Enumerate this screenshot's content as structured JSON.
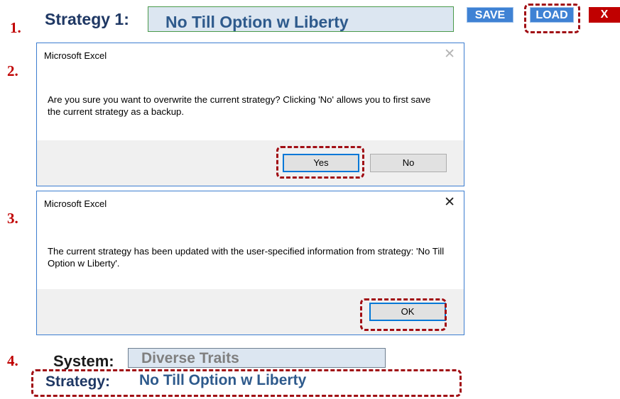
{
  "steps": [
    "1.",
    "2.",
    "3.",
    "4."
  ],
  "strategy_bar": {
    "label": "Strategy 1:",
    "value": "No Till Option w Liberty",
    "save_label": "SAVE",
    "load_label": "LOAD",
    "close_label": "X"
  },
  "dialog_confirm": {
    "title": "Microsoft Excel",
    "close_glyph": "✕",
    "message": "Are you sure you want to overwrite the current strategy? Clicking 'No' allows you to first save the current strategy as a backup.",
    "yes_label": "Yes",
    "no_label": "No"
  },
  "dialog_done": {
    "title": "Microsoft Excel",
    "close_glyph": "✕",
    "message": "The current strategy has been updated with the user-specified information from strategy: 'No Till Option w Liberty'.",
    "ok_label": "OK"
  },
  "result": {
    "system_label": "System:",
    "system_value": "Diverse Traits",
    "strategy_label": "Strategy:",
    "strategy_value": "No Till Option w Liberty"
  },
  "colors": {
    "highlight": "#a10e14",
    "step_number": "#c00000",
    "ribbon_button": "#3f82d4"
  }
}
